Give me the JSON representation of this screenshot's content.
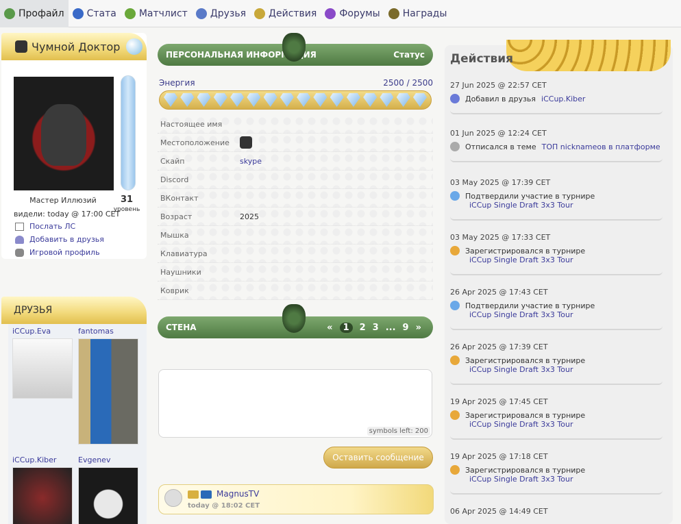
{
  "nav": {
    "tabs": [
      {
        "label": "Профайл",
        "icon": "profile-icon",
        "active": true,
        "color": "#5a9a4a"
      },
      {
        "label": "Стата",
        "icon": "stats-icon",
        "color": "#3a6ac8"
      },
      {
        "label": "Матчлист",
        "icon": "matchlist-icon",
        "color": "#6aa83a"
      },
      {
        "label": "Друзья",
        "icon": "friends-icon",
        "color": "#5a7ac8"
      },
      {
        "label": "Действия",
        "icon": "actions-icon",
        "color": "#c8a83a"
      },
      {
        "label": "Форумы",
        "icon": "forums-icon",
        "color": "#8a4ac8"
      },
      {
        "label": "Награды",
        "icon": "awards-icon",
        "color": "#7a6a2a"
      }
    ]
  },
  "profile": {
    "name": "Чумной Доктор",
    "rank": "Мастер Иллюзий",
    "level": "31",
    "level_label": "уровень",
    "seen": "видели: today @ 17:00 CET",
    "actions": [
      "Послать ЛС",
      "Добавить в друзья",
      "Игровой профиль"
    ]
  },
  "friends": {
    "title": "ДРУЗЬЯ",
    "items": [
      "iCCup.Eva",
      "fantomas",
      "iCCup.Kiber",
      "Evgenev"
    ]
  },
  "personal": {
    "title": "ПЕРСОНАЛЬНАЯ ИНФОРМАЦИЯ",
    "status": "Статус",
    "energy_label": "Энергия",
    "energy_value": "2500 / 2500",
    "energy_fraction": 1.0,
    "rows": [
      {
        "k": "Настоящее имя",
        "v": ""
      },
      {
        "k": "Местоположение",
        "v": ""
      },
      {
        "k": "Скайп",
        "v": "skype"
      },
      {
        "k": "Discord",
        "v": ""
      },
      {
        "k": "ВКонтакт",
        "v": ""
      },
      {
        "k": "Возраст",
        "v": "2025"
      },
      {
        "k": "Мышка",
        "v": ""
      },
      {
        "k": "Клавиатура",
        "v": ""
      },
      {
        "k": "Наушники",
        "v": ""
      },
      {
        "k": "Коврик",
        "v": ""
      }
    ]
  },
  "wall": {
    "title": "СТЕНА",
    "pager": [
      "«",
      "1",
      "2",
      "3",
      "...",
      "9",
      "»"
    ],
    "symbols_left": "symbols left: 200",
    "post_button": "Оставить сообщение",
    "comment": {
      "author": "MagnusTV",
      "time": "today @ 18:02 CET"
    }
  },
  "activity": {
    "title": "Действия",
    "items": [
      {
        "date": "27 Jun 2025 @ 22:57 CET",
        "text": "Добавил в друзья",
        "link": "iCCup.Kiber",
        "sub": "",
        "icon": "add-friend-icon",
        "color": "#6a7ad8"
      },
      {
        "date": "01 Jun 2025 @ 12:24 CET",
        "text": "Отписался в теме",
        "link": "ТОП nicknameов в платформе",
        "sub": "",
        "icon": "forum-post-icon",
        "color": "#aaaaaa"
      },
      {
        "date": "03 May 2025 @ 17:39 CET",
        "text": "Подтвердили участие в турнире",
        "link": "",
        "sub": "iCCup Single Draft 3x3 Tour",
        "icon": "confirm-icon",
        "color": "#6aa8e8"
      },
      {
        "date": "03 May 2025 @ 17:33 CET",
        "text": "Зарегистрировался в турнире",
        "link": "",
        "sub": "iCCup Single Draft 3x3 Tour",
        "icon": "register-icon",
        "color": "#e8a83a"
      },
      {
        "date": "26 Apr 2025 @ 17:43 CET",
        "text": "Подтвердили участие в турнире",
        "link": "",
        "sub": "iCCup Single Draft 3x3 Tour",
        "icon": "confirm-icon",
        "color": "#6aa8e8"
      },
      {
        "date": "26 Apr 2025 @ 17:39 CET",
        "text": "Зарегистрировался в турнире",
        "link": "",
        "sub": "iCCup Single Draft 3x3 Tour",
        "icon": "register-icon",
        "color": "#e8a83a"
      },
      {
        "date": "19 Apr 2025 @ 17:45 CET",
        "text": "Зарегистрировался в турнире",
        "link": "",
        "sub": "iCCup Single Draft 3x3 Tour",
        "icon": "register-icon",
        "color": "#e8a83a"
      },
      {
        "date": "19 Apr 2025 @ 17:18 CET",
        "text": "Зарегистрировался в турнире",
        "link": "",
        "sub": "iCCup Single Draft 3x3 Tour",
        "icon": "register-icon",
        "color": "#e8a83a"
      },
      {
        "date": "06 Apr 2025 @ 14:49 CET",
        "text": "",
        "link": "",
        "sub": "",
        "icon": "",
        "color": ""
      }
    ]
  }
}
